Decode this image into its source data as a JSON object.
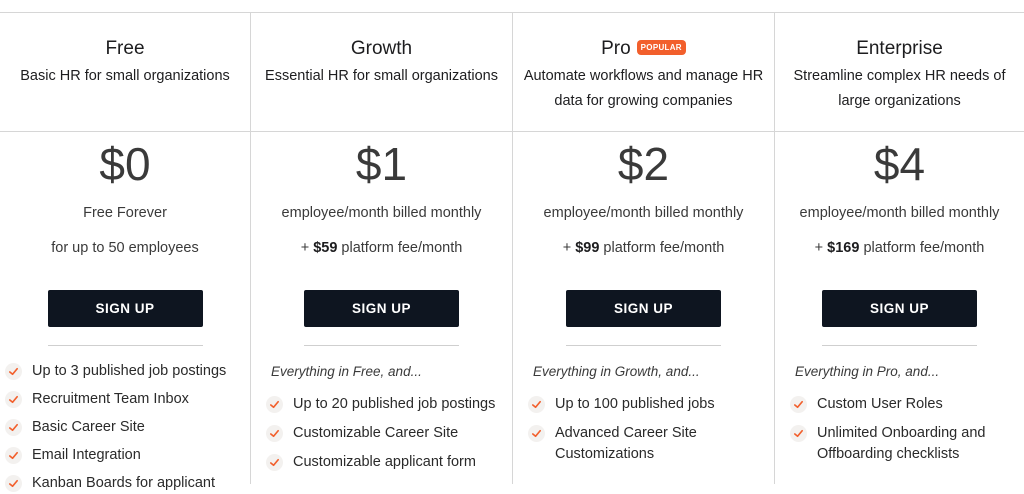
{
  "plans": [
    {
      "name": "Free",
      "badge": "",
      "description": "Basic HR for small organizations",
      "price": "$0",
      "billing": "Free Forever",
      "fee_prefix": "",
      "fee_amount": "",
      "fee_suffix": "for up to 50 employees",
      "cta": "SIGN UP",
      "intro": "",
      "features": [
        "Up to 3 published job postings",
        "Recruitment Team Inbox",
        "Basic Career Site",
        "Email Integration",
        "Kanban Boards for applicant"
      ]
    },
    {
      "name": "Growth",
      "badge": "",
      "description": "Essential HR for small organizations",
      "price": "$1",
      "billing": "employee/month billed monthly",
      "fee_prefix": "+ ",
      "fee_amount": "$59",
      "fee_suffix": " platform fee/month",
      "cta": "SIGN UP",
      "intro": "Everything in Free, and...",
      "features": [
        "Up to 20 published job postings",
        "Customizable Career Site",
        "Customizable applicant form"
      ]
    },
    {
      "name": "Pro",
      "badge": "POPULAR",
      "description": "Automate workflows and manage HR data for growing companies",
      "price": "$2",
      "billing": "employee/month billed monthly",
      "fee_prefix": "+ ",
      "fee_amount": "$99",
      "fee_suffix": " platform fee/month",
      "cta": "SIGN UP",
      "intro": "Everything in Growth, and...",
      "features": [
        "Up to 100 published jobs",
        "Advanced Career Site Customizations"
      ]
    },
    {
      "name": "Enterprise",
      "badge": "",
      "description": "Streamline complex HR needs of large organizations",
      "price": "$4",
      "billing": "employee/month billed monthly",
      "fee_prefix": "+ ",
      "fee_amount": "$169",
      "fee_suffix": " platform fee/month",
      "cta": "SIGN UP",
      "intro": "Everything in Pro, and...",
      "features": [
        "Custom User Roles",
        "Unlimited Onboarding and Offboarding checklists"
      ]
    }
  ],
  "colors": {
    "accent": "#f25f2c",
    "button_bg": "#0e1520",
    "check_bg": "#f3f1ef"
  },
  "icons": {
    "feature_check": "check-icon"
  }
}
